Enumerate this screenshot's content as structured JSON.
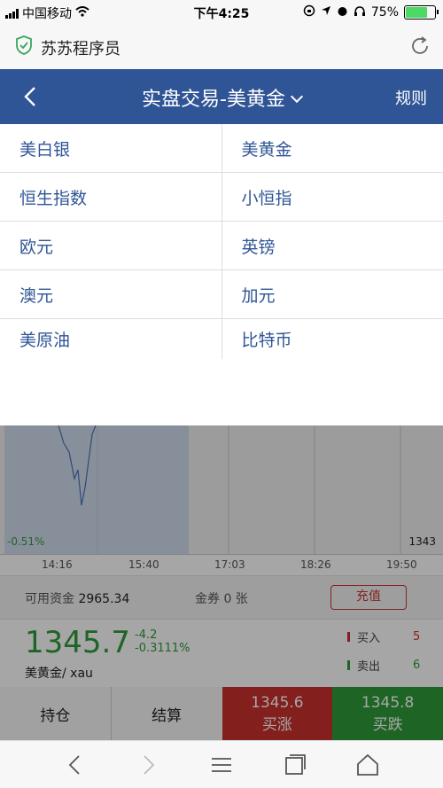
{
  "status": {
    "carrier": "中国移动",
    "time": "下午4:25",
    "battery": "75%"
  },
  "browser": {
    "title": "苏苏程序员"
  },
  "nav": {
    "title": "实盘交易-美黄金",
    "rules": "规则"
  },
  "menu": {
    "rows": [
      [
        "美白银",
        "美黄金"
      ],
      [
        "恒生指数",
        "小恒指"
      ],
      [
        "欧元",
        "英镑"
      ],
      [
        "澳元",
        "加元"
      ],
      [
        "美原油",
        "比特币"
      ]
    ]
  },
  "chart": {
    "low_pct": "-0.51%",
    "low_value": "1343",
    "times": [
      "14:16",
      "15:40",
      "17:03",
      "18:26",
      "19:50"
    ]
  },
  "funds": {
    "available_label": "可用资金",
    "available_value": "2965.34",
    "coupon": "金券 0 张",
    "recharge": "充值"
  },
  "quote": {
    "price": "1345.7",
    "change": "-4.2",
    "change_pct": "-0.3111%",
    "name": "美黄金/ xau",
    "buy_in_label": "买入",
    "buy_in_count": "5",
    "sell_out_label": "卖出",
    "sell_out_count": "6"
  },
  "bottom": {
    "positions": "持仓",
    "settle": "结算",
    "buy_up_price": "1345.6",
    "buy_up_label": "买涨",
    "buy_down_price": "1345.8",
    "buy_down_label": "买跌"
  },
  "colors": {
    "nav_bg": "#2f5596",
    "up_red": "#c9302c",
    "down_green": "#2e9b3a"
  }
}
